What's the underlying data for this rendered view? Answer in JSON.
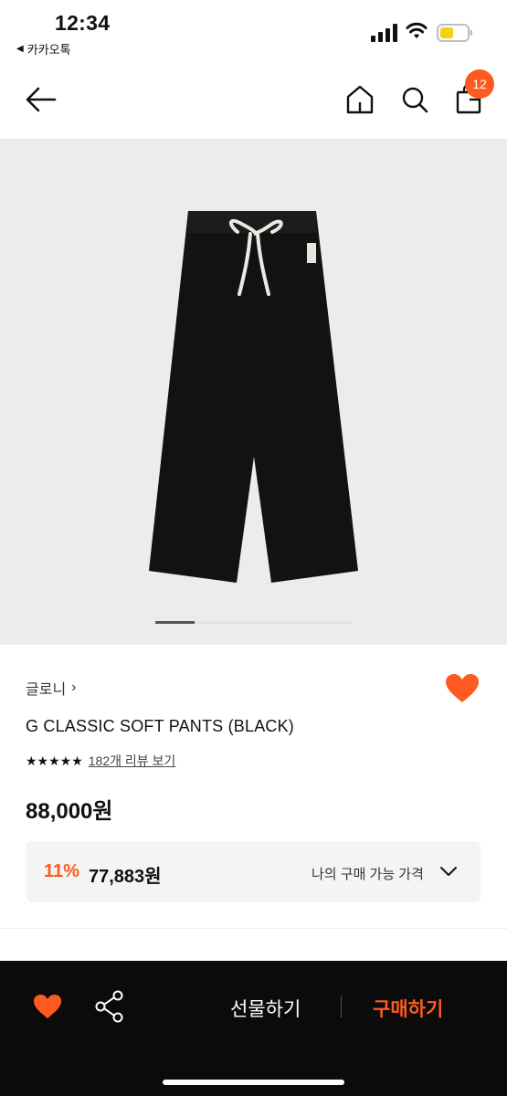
{
  "status_bar": {
    "time": "12:34",
    "back_app": "카카오톡",
    "icons": [
      "signal-icon",
      "wifi-icon",
      "battery-icon"
    ]
  },
  "nav": {
    "icons": [
      "back-arrow-icon",
      "home-icon",
      "search-icon",
      "shopping-bag-icon"
    ],
    "cart_count": "12"
  },
  "gallery": {
    "image": "black wide pants with white drawstring",
    "slide_progress": 0.2
  },
  "product": {
    "brand": "글로니",
    "brand_chevron": "›",
    "title": "G CLASSIC SOFT PANTS (BLACK)",
    "stars": "★★★★★",
    "review_link": "182개 리뷰 보기",
    "price": "88,000원",
    "my_price": {
      "discount": "11%",
      "price": "77,883원",
      "label": "나의 구매 가능 가격"
    }
  },
  "bottom_bar": {
    "gift_label": "선물하기",
    "buy_label": "구매하기"
  },
  "colors": {
    "accent": "#ff5a1f",
    "bottom_bar_bg": "#0b0b0b",
    "image_bg": "#ececec"
  }
}
